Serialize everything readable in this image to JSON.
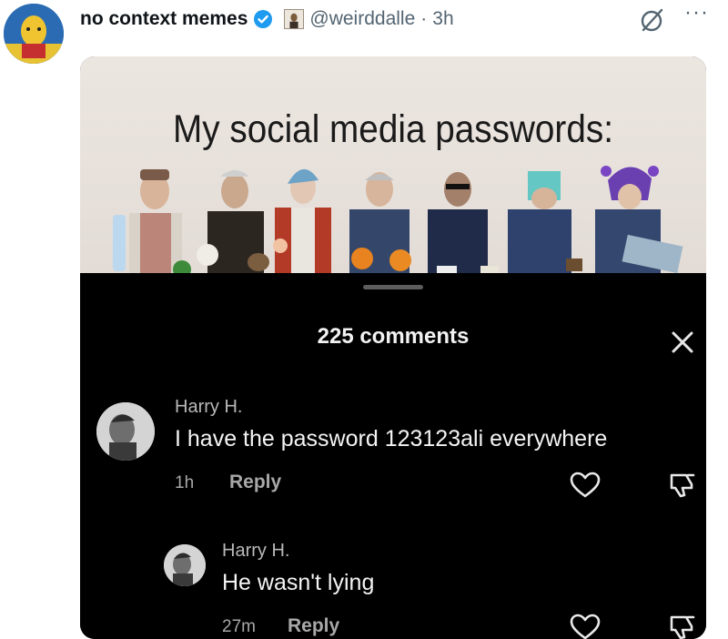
{
  "tweet": {
    "display_name": "no context memes",
    "handle": "@weirddalle",
    "separator": "·",
    "time": "3h",
    "verified_icon": "verified-badge-icon",
    "action_icons": [
      "grok-icon",
      "more-icon"
    ],
    "more_label": "···"
  },
  "meme": {
    "title": "My social media passwords:"
  },
  "comments_sheet": {
    "count_label": "225 comments",
    "close_icon": "close-icon",
    "comments": [
      {
        "name": "Harry H.",
        "text": "I have the password 123123ali everywhere",
        "time": "1h",
        "reply_label": "Reply"
      },
      {
        "name": "Harry H.",
        "text": "He wasn't lying",
        "time": "27m",
        "reply_label": "Reply"
      }
    ]
  },
  "colors": {
    "brand_blue": "#1d9bf0",
    "text_primary": "#0f1419",
    "text_secondary": "#536471",
    "sheet_bg": "#000000"
  }
}
